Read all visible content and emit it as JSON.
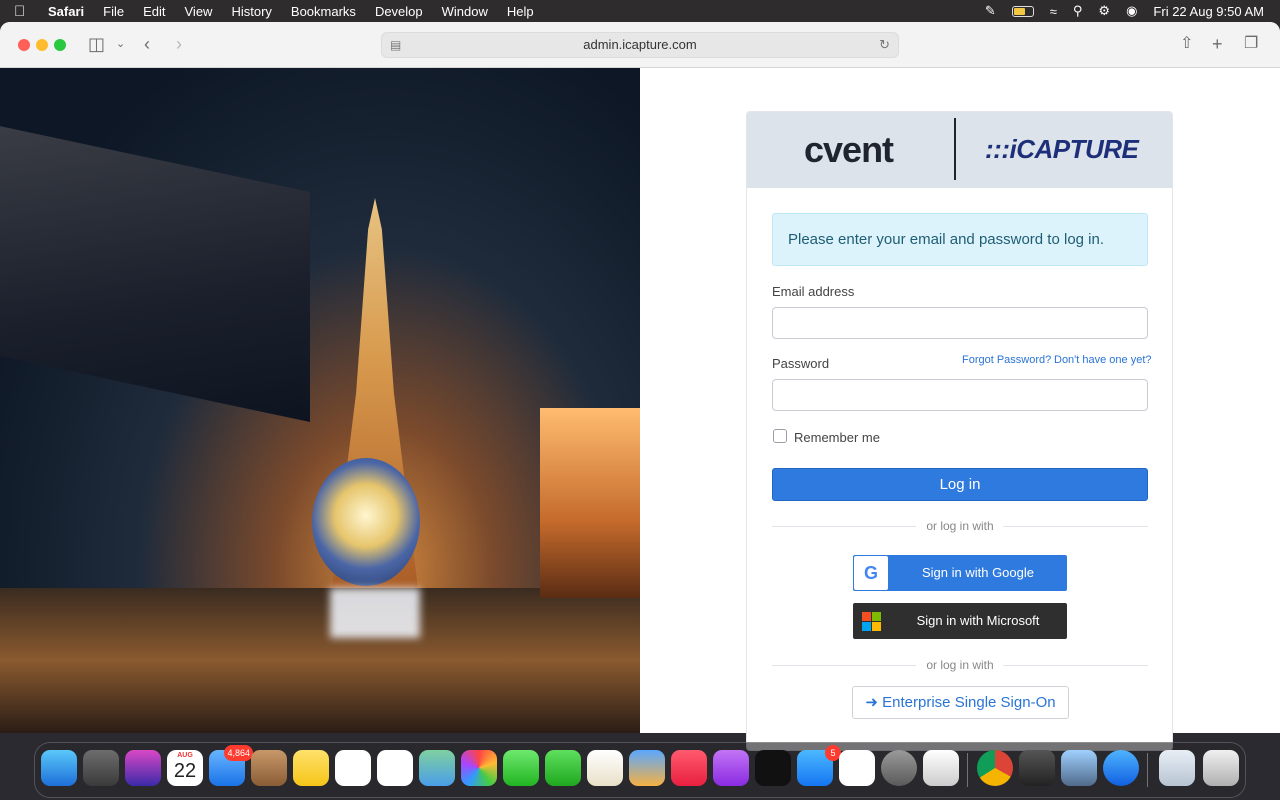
{
  "menubar": {
    "app": "Safari",
    "items": [
      "File",
      "Edit",
      "View",
      "History",
      "Bookmarks",
      "Develop",
      "Window",
      "Help"
    ],
    "clock": "Fri 22 Aug  9:50 AM"
  },
  "browser": {
    "url": "admin.icapture.com"
  },
  "login": {
    "brand_left": "cvent",
    "brand_right": ":::iCAPTURE",
    "alert": "Please enter your email and password to log in.",
    "email_label": "Email address",
    "password_label": "Password",
    "forgot_link": "Forgot Password?",
    "signup_link": "Don't have one yet?",
    "remember_label": "Remember me",
    "login_button": "Log in",
    "or_text": "or log in with",
    "google_button": "Sign in with Google",
    "microsoft_button": "Sign in with Microsoft",
    "sso_button": "Enterprise Single Sign-On"
  },
  "dock": {
    "calendar_month": "AUG",
    "calendar_day": "22",
    "mail_badge": "4,864",
    "appstore_badge": "5"
  },
  "colors": {
    "primary": "#2f7ade",
    "alert_bg": "#dcf3fb",
    "header_bg": "#dde3ea"
  }
}
